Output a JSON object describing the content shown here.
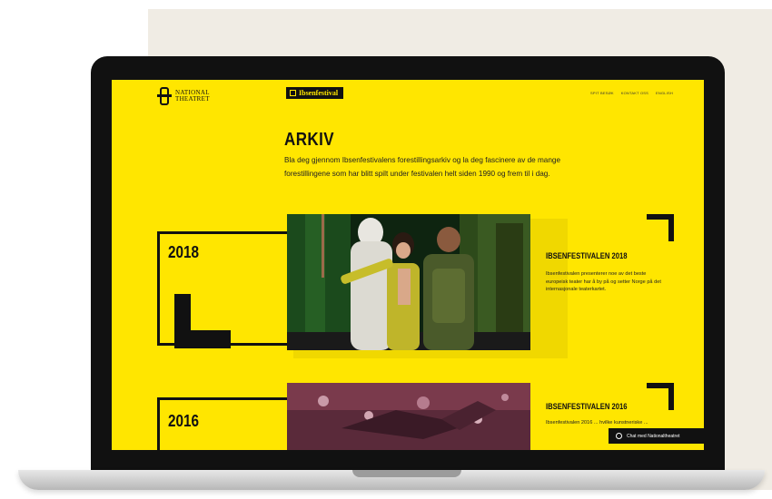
{
  "header": {
    "logo_text": "NATIONAL\nTHEATRET",
    "badge_label": "Ibsenfestival",
    "nav": [
      "SPIT BESØK",
      "KONTAKT OSS",
      "ENGLISH"
    ]
  },
  "page": {
    "title": "ARKIV",
    "intro": "Bla deg gjennom Ibsenfestivalens forestillingsarkiv og la deg fascinere av de mange forestillingene som har blitt spilt under festivalen helt siden 1990 og frem til i dag."
  },
  "archive": [
    {
      "year": "2018",
      "title": "IBSENFESTIVALEN 2018",
      "description": "Ibsenfestivalen presenterer noe av det beste europeisk teater har å by på og setter Norge på det internasjonale teaterkartet."
    },
    {
      "year": "2016",
      "title": "IBSENFESTIVALEN 2016",
      "description": "Ibsenfestivalen 2016 ... hvilke kunstneriske ..."
    }
  ],
  "chat": {
    "label": "Chat med Nationaltheatret"
  },
  "colors": {
    "accent": "#ffe600",
    "ink": "#111111"
  }
}
